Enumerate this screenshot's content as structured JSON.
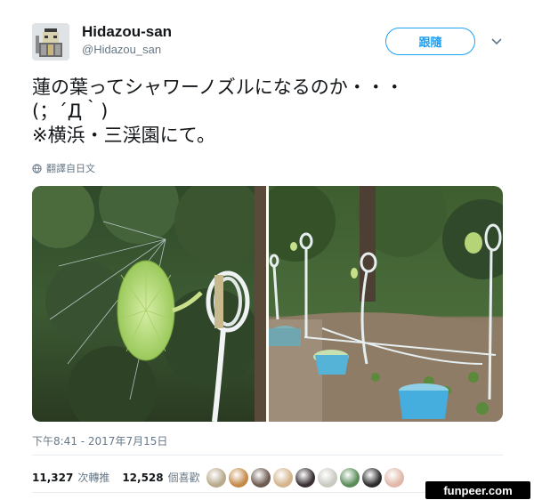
{
  "author": {
    "display_name": "Hidazou-san",
    "handle": "@Hidazou_san"
  },
  "follow_button": {
    "label": "跟隨"
  },
  "tweet": {
    "text": "蓮の葉ってシャワーノズルになるのか・・・\n(；´Д｀)\n※横浜・三渓園にて。",
    "translate_label": "翻譯自日文"
  },
  "photos": [
    {
      "description": "lotus-leaf-shower-closeup"
    },
    {
      "description": "lotus-leaf-showers-garden"
    }
  ],
  "timestamp": "下午8:41 - 2017年7月15日",
  "stats": {
    "retweets_count": "11,327",
    "retweets_label": "次轉推",
    "likes_count": "12,528",
    "likes_label": "個喜歡"
  },
  "liker_avatar_colors": [
    "#b8a98c",
    "#c48a4a",
    "#6d5a50",
    "#d4b48c",
    "#3a3034",
    "#c9c9c2",
    "#5a8c5a",
    "#2c2c2c",
    "#e0b7a8"
  ],
  "watermark": "funpeer.com",
  "colors": {
    "accent": "#1da1f2",
    "text": "#14171a",
    "secondary_text": "#657786"
  },
  "icons": {
    "chevron": "chevron-down-icon",
    "translate": "globe-icon"
  }
}
